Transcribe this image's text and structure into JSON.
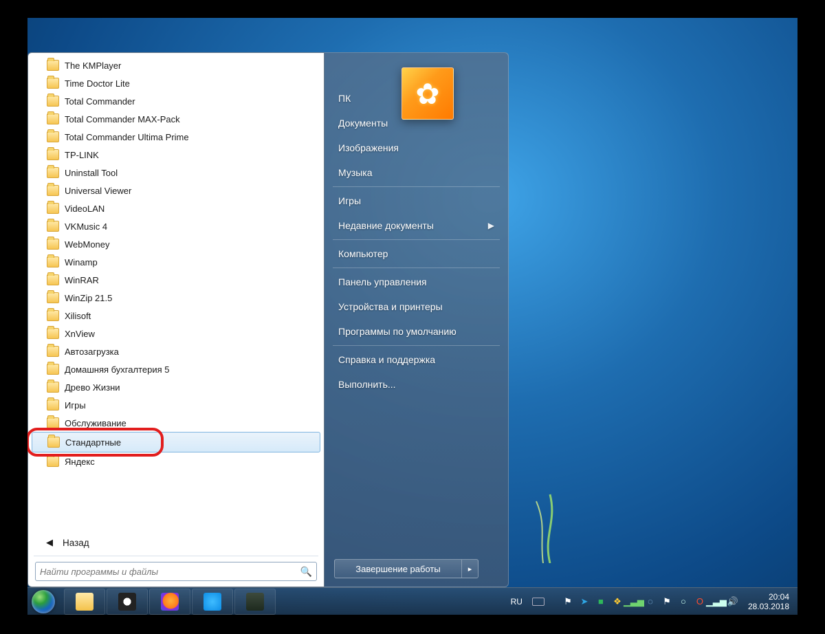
{
  "programs": [
    "The KMPlayer",
    "Time Doctor Lite",
    "Total Commander",
    "Total Commander MAX-Pack",
    "Total Commander Ultima Prime",
    "TP-LINK",
    "Uninstall Tool",
    "Universal Viewer",
    "VideoLAN",
    "VKMusic 4",
    "WebMoney",
    "Winamp",
    "WinRAR",
    "WinZip 21.5",
    "Xilisoft",
    "XnView",
    "Автозагрузка",
    "Домашняя бухгалтерия 5",
    "Древо Жизни",
    "Игры",
    "Обслуживание",
    "Стандартные",
    "Яндекс"
  ],
  "selected_index": 21,
  "back_label": "Назад",
  "search_placeholder": "Найти программы и файлы",
  "right_items": [
    {
      "label": "ПК",
      "sep_after": false,
      "arrow": false
    },
    {
      "label": "Документы",
      "sep_after": false,
      "arrow": false
    },
    {
      "label": "Изображения",
      "sep_after": false,
      "arrow": false
    },
    {
      "label": "Музыка",
      "sep_after": true,
      "arrow": false
    },
    {
      "label": "Игры",
      "sep_after": false,
      "arrow": false
    },
    {
      "label": "Недавние документы",
      "sep_after": true,
      "arrow": true
    },
    {
      "label": "Компьютер",
      "sep_after": true,
      "arrow": false
    },
    {
      "label": "Панель управления",
      "sep_after": false,
      "arrow": false
    },
    {
      "label": "Устройства и принтеры",
      "sep_after": false,
      "arrow": false
    },
    {
      "label": "Программы по умолчанию",
      "sep_after": true,
      "arrow": false
    },
    {
      "label": "Справка и поддержка",
      "sep_after": false,
      "arrow": false
    },
    {
      "label": "Выполнить...",
      "sep_after": false,
      "arrow": false
    }
  ],
  "shutdown_label": "Завершение работы",
  "tray": {
    "lang": "RU",
    "time": "20:04",
    "date": "28.03.2018"
  },
  "taskbar_apps": [
    {
      "name": "explorer",
      "bg": "linear-gradient(#ffe9a8,#f4c24a)"
    },
    {
      "name": "panda",
      "bg": "radial-gradient(circle,#fff 30%,#222 31%),#fff"
    },
    {
      "name": "firefox",
      "bg": "radial-gradient(circle at 55% 45%,#ffb03a 0%,#ff7a1a 55%,#8a2be2 60%,#3b5bdb 100%)"
    },
    {
      "name": "skype",
      "bg": "radial-gradient(circle,#3fbcff,#0d8de6)"
    },
    {
      "name": "terminal",
      "bg": "linear-gradient(#3d4a3d,#1e2a1e)"
    }
  ],
  "tray_icons": [
    {
      "name": "flag-icon",
      "glyph": "⚑",
      "color": "#fff"
    },
    {
      "name": "telegram-icon",
      "glyph": "➤",
      "color": "#2fa8e6"
    },
    {
      "name": "green-box-icon",
      "glyph": "■",
      "color": "#2fb85a"
    },
    {
      "name": "palette-icon",
      "glyph": "❖",
      "color": "#ffcc33"
    },
    {
      "name": "signal-icon",
      "glyph": "▁▃▅",
      "color": "#6fd36f"
    },
    {
      "name": "globe-icon",
      "glyph": "◌",
      "color": "#9bd3ff"
    },
    {
      "name": "flag2-icon",
      "glyph": "⚑",
      "color": "#fff"
    },
    {
      "name": "circle-icon",
      "glyph": "○",
      "color": "#cfe"
    },
    {
      "name": "opera-icon",
      "glyph": "O",
      "color": "#ff4d2e"
    },
    {
      "name": "wifi-icon",
      "glyph": "▁▃▅",
      "color": "#cfe"
    },
    {
      "name": "sound-icon",
      "glyph": "🔊",
      "color": "#fff"
    }
  ]
}
